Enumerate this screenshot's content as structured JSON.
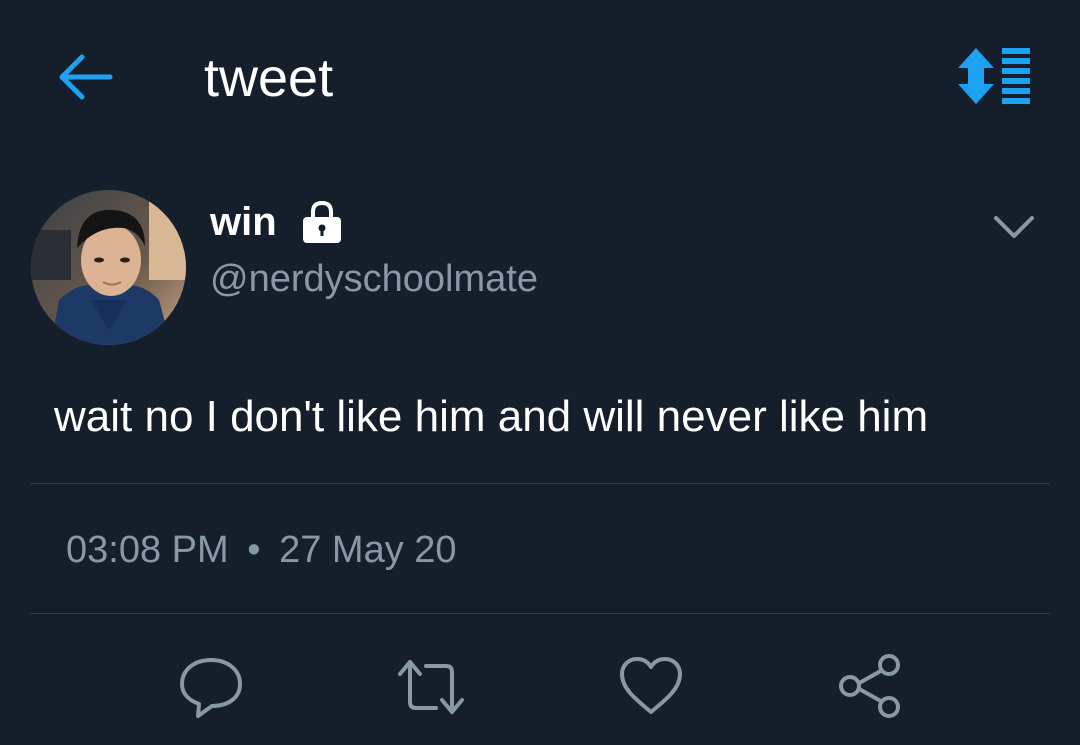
{
  "header": {
    "title": "tweet",
    "back_icon": "arrow-left-icon",
    "sort_icon": "sort-thread-icon"
  },
  "tweet": {
    "display_name": "win",
    "protected_icon": "lock-icon",
    "handle": "@nerdyschoolmate",
    "text": "wait no I don't like him and will never like him",
    "time": "03:08 PM",
    "separator": "•",
    "date": "27 May 20"
  },
  "actions": [
    {
      "icon": "reply-icon"
    },
    {
      "icon": "retweet-icon"
    },
    {
      "icon": "like-icon"
    },
    {
      "icon": "share-icon"
    }
  ],
  "colors": {
    "background": "#151f2b",
    "accent": "#1da1f2",
    "text": "#ffffff",
    "secondary_text": "#8899a6",
    "divider": "#2f3b48"
  }
}
